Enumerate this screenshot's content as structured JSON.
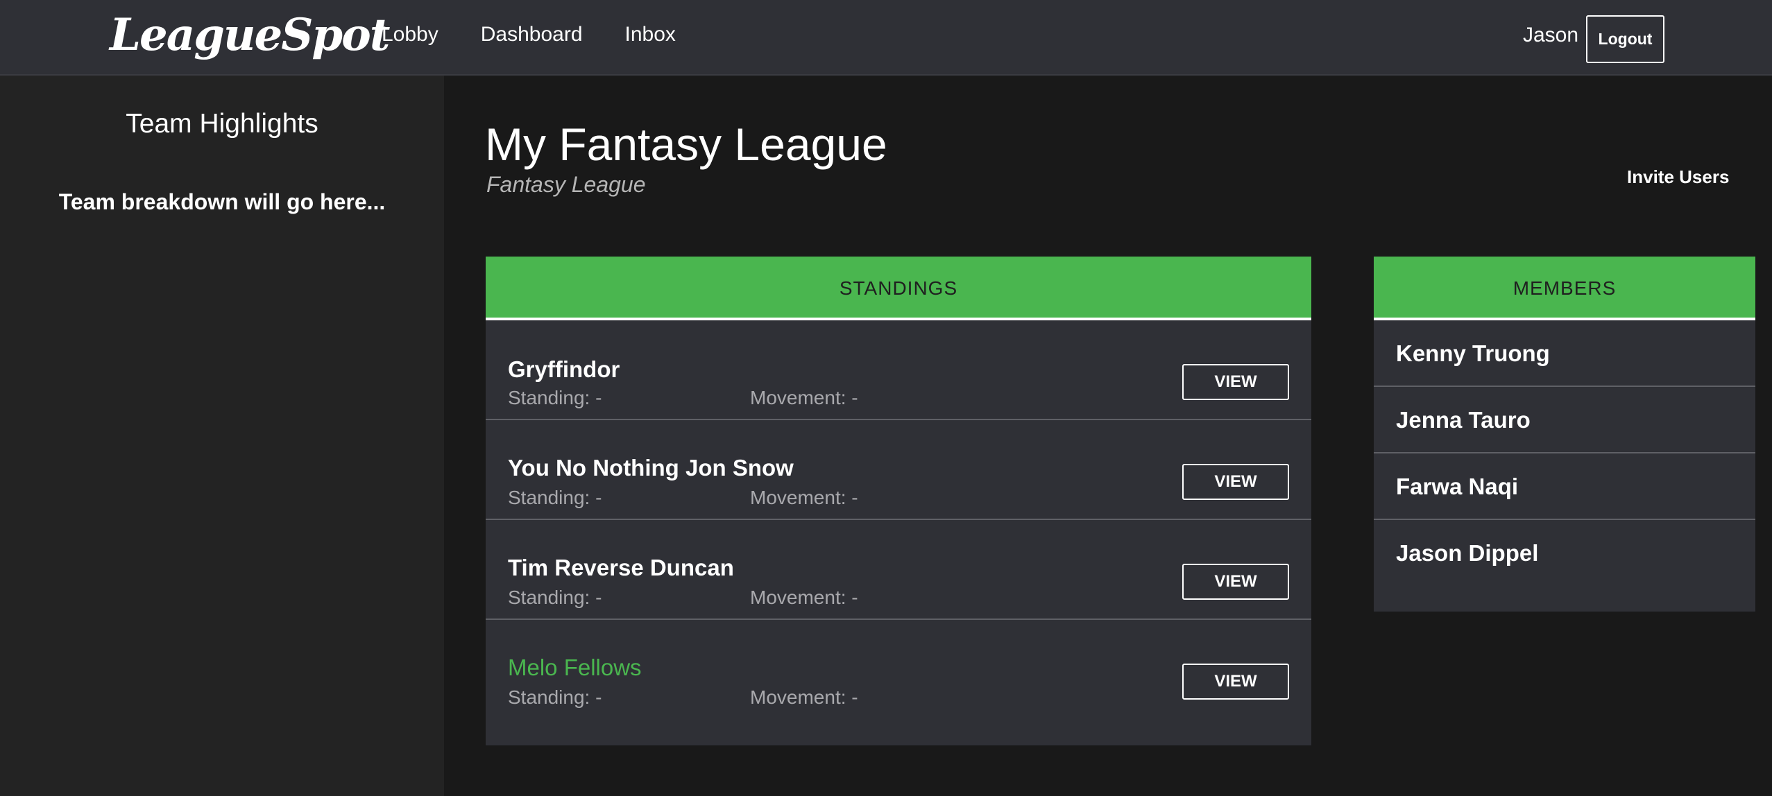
{
  "navbar": {
    "logo": "LeagueSpot",
    "links": [
      "Lobby",
      "Dashboard",
      "Inbox"
    ],
    "user": "Jason",
    "logout_label": "Logout"
  },
  "sidebar": {
    "title": "Team Highlights",
    "text": "Team breakdown will go here..."
  },
  "main": {
    "title": "My Fantasy League",
    "subtitle": "Fantasy League",
    "invite_label": "Invite Users"
  },
  "standings": {
    "header": "STANDINGS",
    "rows": [
      {
        "team": "Gryffindor",
        "standing": "Standing: -",
        "movement": "Movement: -",
        "view_label": "VIEW",
        "highlight": false
      },
      {
        "team": "You No Nothing Jon Snow",
        "standing": "Standing: -",
        "movement": "Movement: -",
        "view_label": "VIEW",
        "highlight": false
      },
      {
        "team": "Tim Reverse Duncan",
        "standing": "Standing: -",
        "movement": "Movement: -",
        "view_label": "VIEW",
        "highlight": false
      },
      {
        "team": "Melo Fellows",
        "standing": "Standing: -",
        "movement": "Movement: -",
        "view_label": "VIEW",
        "highlight": true
      }
    ]
  },
  "members": {
    "header": "MEMBERS",
    "items": [
      "Kenny Truong",
      "Jenna Tauro",
      "Farwa Naqi",
      "Jason Dippel"
    ]
  },
  "colors": {
    "accent": "#4ab64f",
    "navbar_bg": "#2f3036",
    "page_bg": "#191919",
    "sidebar_bg": "#232323"
  }
}
